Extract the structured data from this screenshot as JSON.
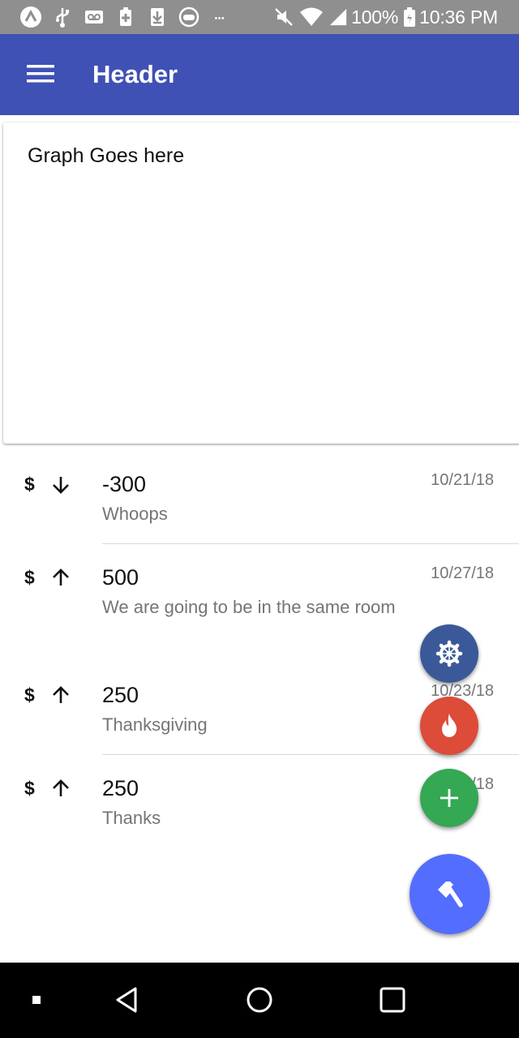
{
  "status_bar": {
    "battery": "100%",
    "time": "10:36 PM",
    "overflow": "···",
    "left_icons": [
      "app-logo-icon",
      "usb-icon",
      "voicemail-icon",
      "battery-plus-icon",
      "download-icon",
      "gamepad-icon",
      "overflow-dots-icon"
    ],
    "right_icons": [
      "mute-icon",
      "wifi-icon",
      "signal-icon",
      "battery-icon"
    ]
  },
  "app_bar": {
    "title": "Header",
    "menu_icon": "menu-icon",
    "color": "#3f51b5"
  },
  "graph_card": {
    "text": "Graph Goes here"
  },
  "transactions": [
    {
      "currency": "$",
      "direction": "down",
      "amount": "-300",
      "note": "Whoops",
      "date": "10/21/18"
    },
    {
      "currency": "$",
      "direction": "up",
      "amount": "500",
      "note": "We are going to be in the same room",
      "date": "10/27/18"
    },
    {
      "currency": "$",
      "direction": "up",
      "amount": "250",
      "note": "Thanksgiving",
      "date": "10/23/18"
    },
    {
      "currency": "$",
      "direction": "up",
      "amount": "250",
      "note": "Thanks",
      "date": "10/18"
    }
  ],
  "fabs": [
    {
      "name": "settings",
      "icon": "gear-icon",
      "color": "#3b5998"
    },
    {
      "name": "fire",
      "icon": "fire-icon",
      "color": "#dd4b39"
    },
    {
      "name": "add",
      "icon": "plus-icon",
      "color": "#34a853"
    },
    {
      "name": "build",
      "icon": "hammer-icon",
      "color": "#536dfe"
    }
  ],
  "nav_bar": {
    "buttons": [
      "back-icon",
      "home-icon",
      "recents-icon"
    ]
  }
}
